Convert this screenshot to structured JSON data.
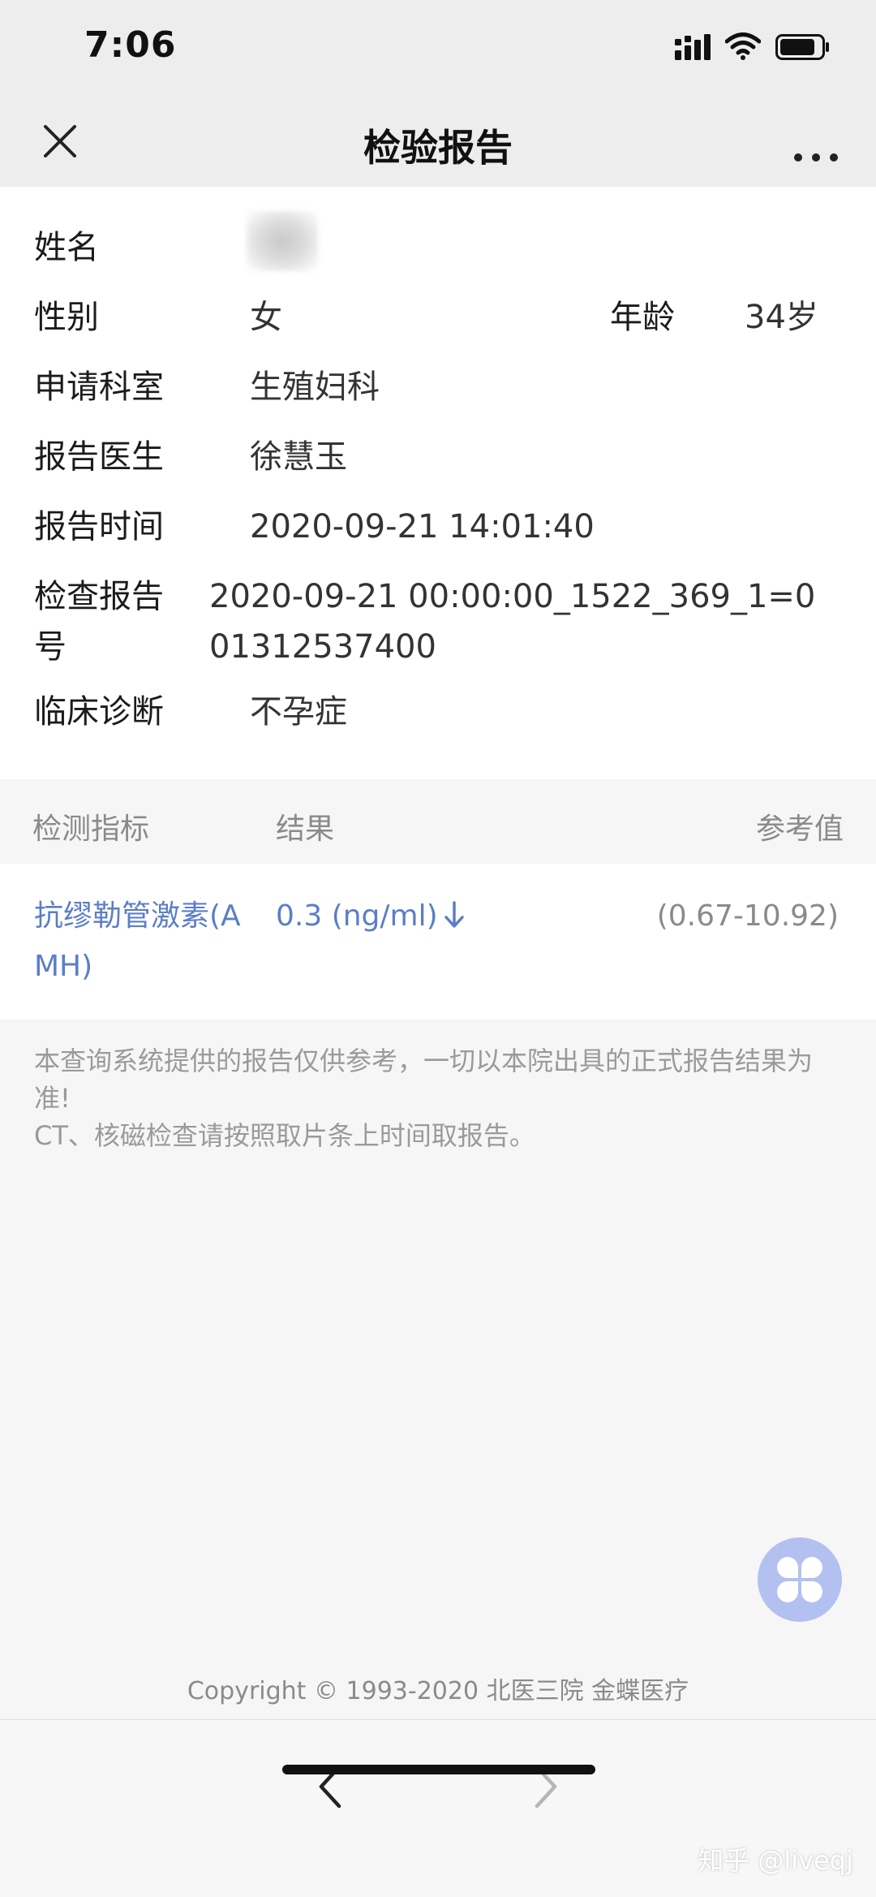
{
  "status_bar": {
    "time": "7:06"
  },
  "nav": {
    "title": "检验报告"
  },
  "info": {
    "name_label": "姓名",
    "gender_label": "性别",
    "gender_value": "女",
    "age_label": "年龄",
    "age_value": "34岁",
    "department_label": "申请科室",
    "department_value": "生殖妇科",
    "doctor_label": "报告医生",
    "doctor_value": "徐慧玉",
    "report_time_label": "报告时间",
    "report_time_value": "2020-09-21 14:01:40",
    "report_no_label": "检查报告号",
    "report_no_value": "2020-09-21 00:00:00_1522_369_1=001312537400",
    "diagnosis_label": "临床诊断",
    "diagnosis_value": "不孕症"
  },
  "table": {
    "headers": [
      "检测指标",
      "结果",
      "参考值"
    ],
    "rows": [
      {
        "indicator": "抗缪勒管激素(AMH)",
        "result": "0.3  (ng/ml)",
        "flag": "low",
        "reference": "(0.67-10.92)"
      }
    ]
  },
  "notice": {
    "line1": "本查询系统提供的报告仅供参考，一切以本院出具的正式报告结果为准!",
    "line2": "CT、核磁检查请按照取片条上时间取报告。"
  },
  "footer": {
    "copyright": "Copyright © 1993-2020 北医三院 金蝶医疗",
    "watermark": "知乎 @liveqj"
  },
  "icons": {
    "close": "close-icon",
    "more": "more-icon",
    "back": "chevron-left-icon",
    "forward": "chevron-right-icon",
    "float": "clover-icon",
    "down_arrow": "arrow-down-icon"
  },
  "colors": {
    "link_blue": "#5b7ec7",
    "float_button": "#b3c1f1",
    "forward_disabled": "#b5b5b5"
  }
}
